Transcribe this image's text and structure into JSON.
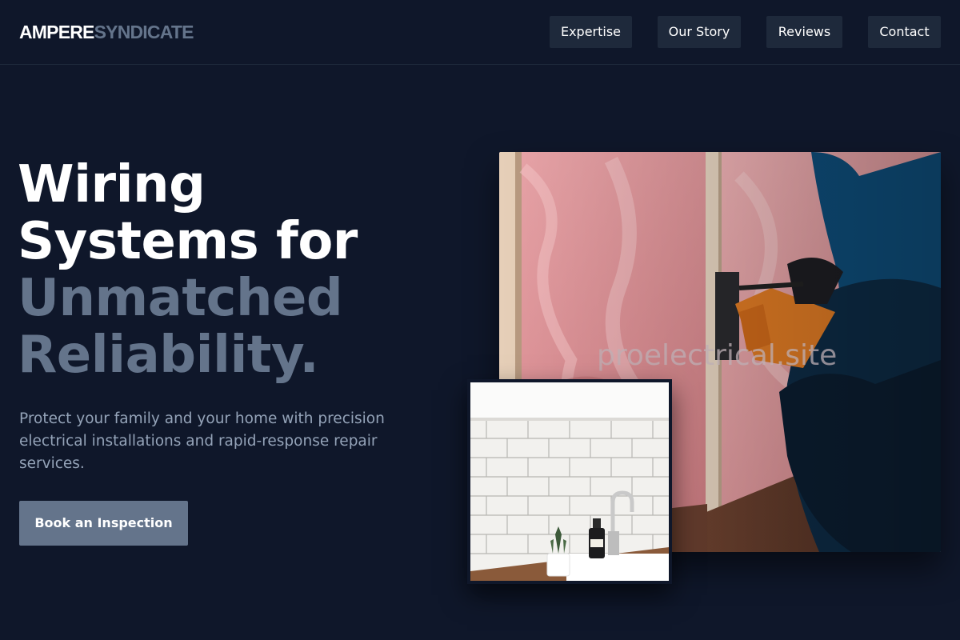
{
  "header": {
    "logo_part1": "AMPERE",
    "logo_part2": "SYNDICATE",
    "nav": {
      "expertise": "Expertise",
      "story": "Our Story",
      "reviews": "Reviews",
      "contact": "Contact"
    }
  },
  "hero": {
    "title_line1": "Wiring",
    "title_line2": "Systems for",
    "title_line3": "Unmatched",
    "title_line4": "Reliability.",
    "description": "Protect your family and your home with precision electrical installations and rapid-response repair services.",
    "cta_label": "Book an Inspection",
    "watermark": "proelectrical.site"
  },
  "colors": {
    "background": "#0f172a",
    "nav_button": "#1e293b",
    "accent": "#64748b",
    "muted_text": "#94a3b8"
  }
}
